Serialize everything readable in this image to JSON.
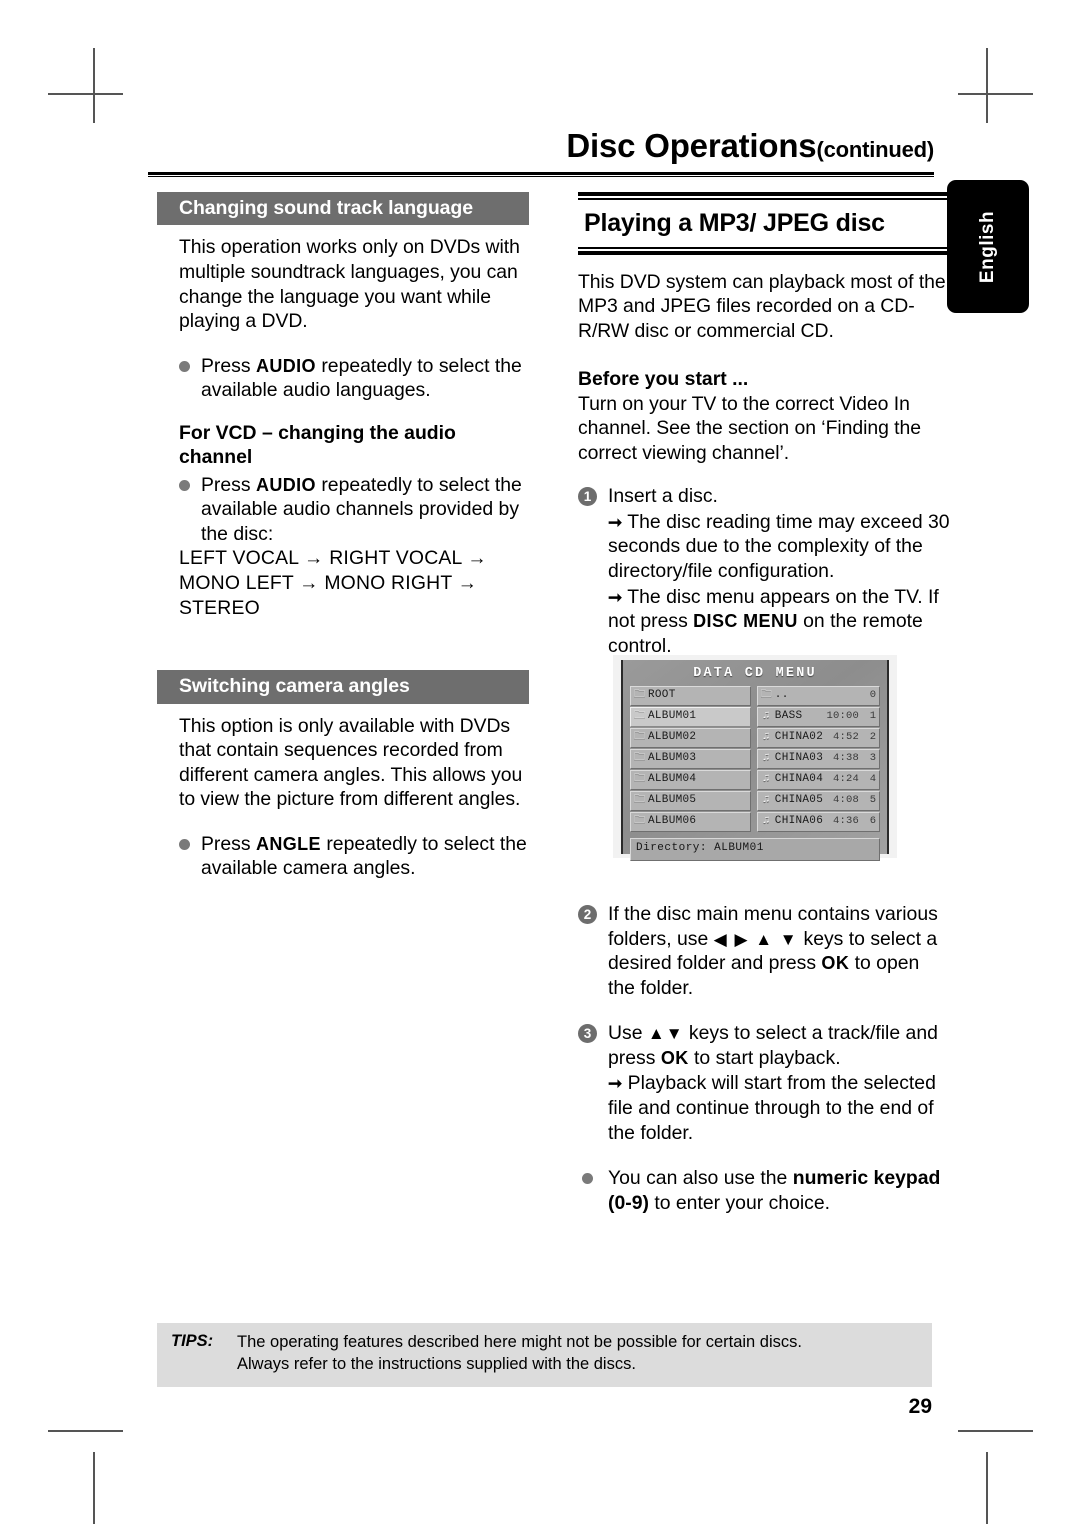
{
  "page": {
    "title_main": "Disc Operations",
    "title_suffix": "(continued)",
    "number": "29",
    "language_tab": "English"
  },
  "left_column": {
    "section1": {
      "heading": "Changing sound track language",
      "intro": "This operation works only on DVDs with multiple soundtrack languages, you can change the language you want while playing a DVD.",
      "bullet1_pre": "Press ",
      "bullet1_key": "AUDIO",
      "bullet1_post": " repeatedly to select the available audio languages.",
      "sub_heading": "For VCD – changing the audio channel",
      "bullet2_pre": "Press ",
      "bullet2_key": "AUDIO",
      "bullet2_post": " repeatedly to select the available audio channels provided by the disc:",
      "channel_sequence": "LEFT VOCAL → RIGHT VOCAL → MONO LEFT → MONO RIGHT → STEREO"
    },
    "section2": {
      "heading": "Switching camera angles",
      "intro": "This option is only available with DVDs that contain sequences recorded from different camera angles. This allows you to view the picture from different angles.",
      "bullet1_pre": "Press ",
      "bullet1_key": "ANGLE",
      "bullet1_post": " repeatedly to select the available camera angles."
    }
  },
  "right_column": {
    "heading": "Playing a MP3/ JPEG disc",
    "intro": "This DVD system can playback most of the MP3 and JPEG files recorded on a CD-R/RW disc or commercial CD.",
    "before_heading": "Before you start ...",
    "before_text": "Turn on your TV to the correct Video In channel.  See the section on ‘Finding the correct viewing channel’.",
    "step1": {
      "number": "1",
      "text": "Insert a disc.",
      "arrow1": "The disc reading time may exceed 30 seconds due to the complexity of the directory/file configuration.",
      "arrow2_pre": "The disc menu appears on the TV. If not press ",
      "arrow2_key": "DISC MENU",
      "arrow2_post": " on the remote control."
    },
    "step2": {
      "number": "2",
      "pre": "If the disc main menu contains various folders, use ",
      "keys": "◀ ▶ ▲ ▼",
      "mid": " keys to select a desired folder and press ",
      "ok": "OK",
      "post": " to open the folder."
    },
    "step3": {
      "number": "3",
      "pre": "Use ",
      "keys": "▲▼",
      "mid": " keys to select a track/file and press ",
      "ok": "OK",
      "post": " to start playback.",
      "arrow1": "Playback will start from the selected file and continue through to the end of the folder."
    },
    "bullet_final_pre": "You can also use the ",
    "bullet_final_bold": "numeric keypad",
    "bullet_final_mid": " ",
    "bullet_final_range": "(0-9)",
    "bullet_final_post": " to enter your choice."
  },
  "tv_screenshot": {
    "title": "DATA CD MENU",
    "folders": [
      {
        "icon": "folder-icon",
        "label": "ROOT",
        "selected": false
      },
      {
        "icon": "folder-icon",
        "label": "ALBUM01",
        "selected": true
      },
      {
        "icon": "folder-icon",
        "label": "ALBUM02",
        "selected": false
      },
      {
        "icon": "folder-icon",
        "label": "ALBUM03",
        "selected": false
      },
      {
        "icon": "folder-icon",
        "label": "ALBUM04",
        "selected": false
      },
      {
        "icon": "folder-icon",
        "label": "ALBUM05",
        "selected": false
      },
      {
        "icon": "folder-icon",
        "label": "ALBUM06",
        "selected": false
      }
    ],
    "files": [
      {
        "icon": "folder-up-icon",
        "label": "..",
        "time": "",
        "index": "0"
      },
      {
        "icon": "mp3-icon",
        "label": "BASS",
        "time": "10:00",
        "index": "1"
      },
      {
        "icon": "mp3-icon",
        "label": "CHINA02",
        "time": "4:52",
        "index": "2"
      },
      {
        "icon": "mp3-icon",
        "label": "CHINA03",
        "time": "4:38",
        "index": "3"
      },
      {
        "icon": "mp3-icon",
        "label": "CHINA04",
        "time": "4:24",
        "index": "4"
      },
      {
        "icon": "mp3-icon",
        "label": "CHINA05",
        "time": "4:08",
        "index": "5"
      },
      {
        "icon": "mp3-icon",
        "label": "CHINA06",
        "time": "4:36",
        "index": "6"
      }
    ],
    "status": "Directory: ALBUM01"
  },
  "tips": {
    "label": "TIPS:",
    "line1": "The operating features described here might not be possible for certain discs.",
    "line2": "Always refer to the instructions supplied with the discs."
  },
  "colors": {
    "section_bar": "#6e6e6e",
    "tips_background": "#dcdcdc",
    "bullet": "#7a7a7a",
    "tab_background": "#000000"
  }
}
